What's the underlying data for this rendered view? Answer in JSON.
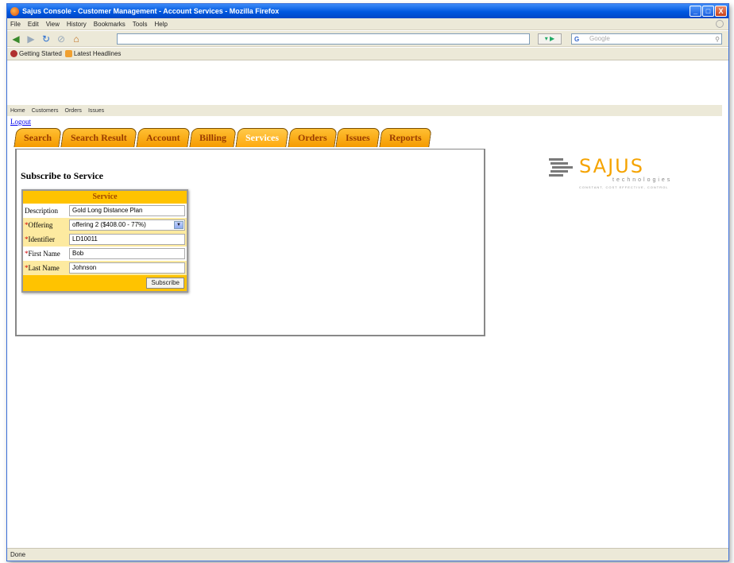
{
  "window": {
    "title": "Sajus Console - Customer Management - Account Services - Mozilla Firefox",
    "buttons": {
      "minimize": "_",
      "maximize": "□",
      "close": "X"
    }
  },
  "menu": [
    "File",
    "Edit",
    "View",
    "History",
    "Bookmarks",
    "Tools",
    "Help"
  ],
  "toolbar": {
    "url": "",
    "search_placeholder": "Google",
    "search_engine": "G"
  },
  "bookmarks": [
    "Getting Started",
    "Latest Headlines"
  ],
  "page": {
    "topnav": [
      "Home",
      "Customers",
      "Orders",
      "Issues"
    ],
    "logout": "Logout",
    "tabs": [
      {
        "label": "Search",
        "active": false
      },
      {
        "label": "Search Result",
        "active": false
      },
      {
        "label": "Account",
        "active": false
      },
      {
        "label": "Billing",
        "active": false
      },
      {
        "label": "Services",
        "active": true
      },
      {
        "label": "Orders",
        "active": false
      },
      {
        "label": "Issues",
        "active": false
      },
      {
        "label": "Reports",
        "active": false
      }
    ],
    "section_title": "Subscribe to Service",
    "form": {
      "header": "Service",
      "rows": {
        "description": {
          "label": "Description",
          "value": "Gold Long Distance Plan"
        },
        "offering": {
          "label": "Offering",
          "value": "offering 2 ($408.00 - 77%)"
        },
        "identifier": {
          "label": "Identifier",
          "value": "LD10011"
        },
        "first_name": {
          "label": "First Name",
          "value": "Bob"
        },
        "last_name": {
          "label": "Last Name",
          "value": "Johnson"
        }
      },
      "required_marker": "*",
      "submit": "Subscribe"
    },
    "logo": {
      "name": "SAJUS",
      "sub": "technologies",
      "tagline": "CONSTANT, COST EFFECTIVE, CONTROL"
    }
  },
  "status": "Done",
  "colors": {
    "tab": "#f59b00",
    "form_header": "#ffc300",
    "logo": "#f5a300",
    "titlebar": "#0058e0"
  }
}
